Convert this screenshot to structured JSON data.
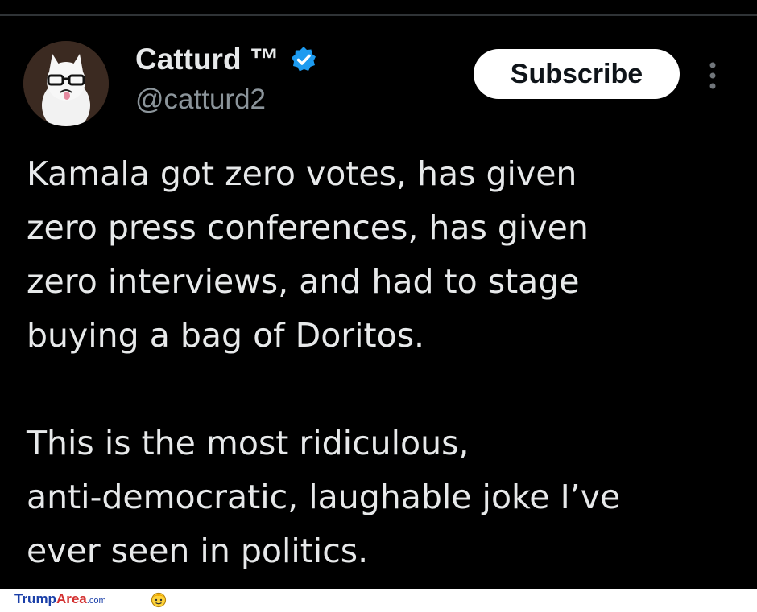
{
  "tweet": {
    "author": {
      "display_name": "Catturd ™",
      "handle": "@catturd2",
      "verified_badge_color": "#1d9bf0"
    },
    "subscribe_label": "Subscribe",
    "text": "Kamala got zero votes, has given\nzero press conferences, has given\nzero interviews, and had to stage\nbuying a bag of Doritos.\n\nThis is the most ridiculous,\nanti-democratic, laughable joke I’ve\never seen in politics."
  },
  "watermark": {
    "brand_part1": "Trump",
    "brand_part2": "Area",
    "brand_part3": ".com"
  },
  "icons": {
    "verified": "verified-badge-icon",
    "more": "more-options-icon",
    "mascot": "mascot-icon"
  },
  "colors": {
    "background": "#000000",
    "text_primary": "#e7e9ea",
    "text_secondary": "#8b949a",
    "button_bg": "#ffffff",
    "button_text": "#0f1419"
  }
}
